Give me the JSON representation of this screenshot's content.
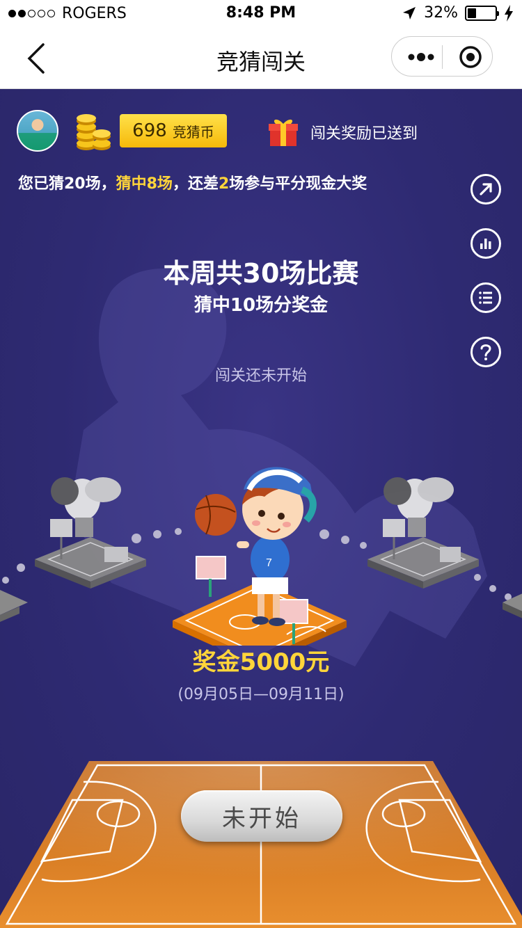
{
  "status_bar": {
    "carrier": "ROGERS",
    "time": "8:48 PM",
    "battery": "32%",
    "battery_level": 0.32
  },
  "nav": {
    "title": "竞猜闯关"
  },
  "user": {
    "coins": "698",
    "coin_unit": "竞猜币",
    "reward_notice": "闯关奖励已送到"
  },
  "progress": {
    "prefix": "您已猜20场，",
    "hit": "猜中8场",
    "middle": "，还差",
    "remaining": "2",
    "suffix": "场参与平分现金大奖"
  },
  "side_actions": [
    "share-icon",
    "stats-icon",
    "list-icon",
    "help-icon"
  ],
  "week": {
    "headline": "本周共30场比赛",
    "subline": "猜中10场分奖金",
    "status": "闯关还未开始"
  },
  "prize": {
    "amount": "奖金5000元",
    "period": "(09月05日—09月11日)"
  },
  "button": {
    "label": "未开始"
  },
  "colors": {
    "background": "#2e2a72",
    "highlight": "#ffd53a",
    "court": "#e8881c"
  }
}
